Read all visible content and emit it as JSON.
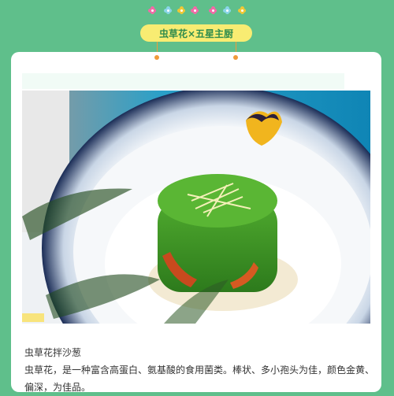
{
  "header": {
    "banner_title": "虫草花×五星主厨",
    "flower_colors": [
      "#f26aa7",
      "#8ad5e8",
      "#f0c836",
      "#f26aa7",
      "#f26aa7",
      "#8ad5e8",
      "#f0c836"
    ]
  },
  "article": {
    "image_alt": "虫草花拌沙葱 dish photo",
    "caption": "虫草花拌沙葱",
    "body": "虫草花，是一种富含高蛋白、氨基酸的食用菌类。棒状、多小孢头为佳，颜色金黄、偏深，为佳品。"
  },
  "colors": {
    "page_background": "#5fbf8b",
    "banner_pill": "#f8ec72",
    "banner_text": "#2f8c4d",
    "accent_orange": "#f09a3a"
  }
}
